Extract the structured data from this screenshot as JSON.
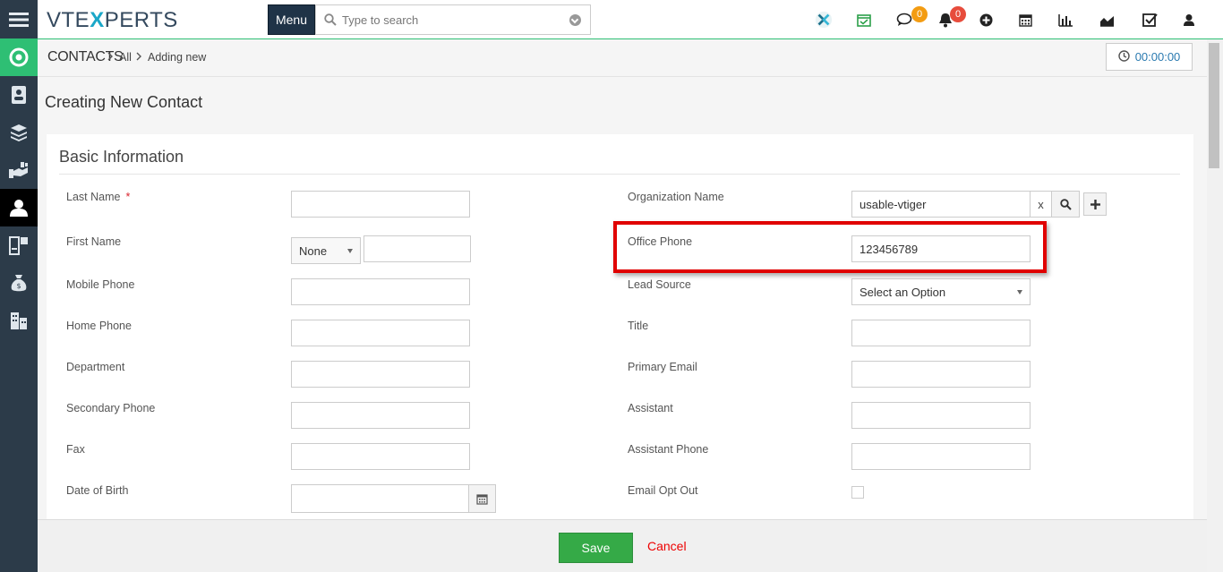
{
  "header": {
    "logo_text_1": "VTE",
    "logo_text_x": "X",
    "logo_text_2": "PERTS",
    "menu_label": "Menu",
    "search_placeholder": "Type to search",
    "chat_badge": "0",
    "notification_badge": "0"
  },
  "breadcrumb": {
    "module": "CONTACTS",
    "filter": "All",
    "current": "Adding new"
  },
  "timer": "00:00:00",
  "page_title": "Creating New Contact",
  "section_title": "Basic Information",
  "left_fields": [
    {
      "label": "Last Name",
      "value": ""
    },
    {
      "label": "First Name",
      "value": ""
    },
    {
      "label": "Mobile Phone",
      "value": ""
    },
    {
      "label": "Home Phone",
      "value": ""
    },
    {
      "label": "Department",
      "value": ""
    },
    {
      "label": "Secondary Phone",
      "value": ""
    },
    {
      "label": "Fax",
      "value": ""
    },
    {
      "label": "Date of Birth",
      "value": ""
    }
  ],
  "salutation": "None",
  "required_mark": "*",
  "right_fields": [
    {
      "label": "Organization Name",
      "value": "usable-vtiger"
    },
    {
      "label": "Office Phone",
      "value": "123456789"
    },
    {
      "label": "Lead Source",
      "value": "Select an Option"
    },
    {
      "label": "Title",
      "value": ""
    },
    {
      "label": "Primary Email",
      "value": ""
    },
    {
      "label": "Assistant",
      "value": ""
    },
    {
      "label": "Assistant Phone",
      "value": ""
    },
    {
      "label": "Email Opt Out",
      "value": ""
    }
  ],
  "org_clear": "x",
  "footer": {
    "save_label": "Save",
    "cancel_label": "Cancel"
  },
  "colors": {
    "accent_green": "#2ebf74",
    "rail_bg": "#2c3b49",
    "save_green": "#35aa47",
    "cancel_red": "#e00000",
    "highlight_red": "#e00000",
    "badge_orange": "#f39c12",
    "badge_red": "#e74c3c"
  }
}
